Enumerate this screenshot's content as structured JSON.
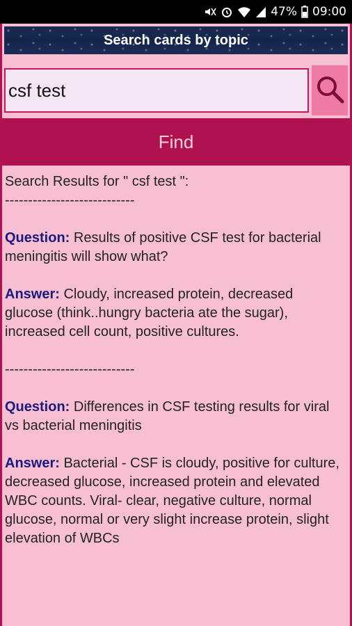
{
  "status": {
    "battery_percent": "47%",
    "time": "09:00"
  },
  "header": {
    "title": "Search cards by topic"
  },
  "search": {
    "query": "csf test",
    "find_label": "Find"
  },
  "results": {
    "heading": "Search Results for \" csf test \":",
    "divider": "----------------------------",
    "question_label": "Question:",
    "answer_label": "Answer:",
    "items": [
      {
        "question": "Results of positive CSF test for bacterial meningitis will show what?",
        "answer": "Cloudy, increased protein, decreased glucose (think..hungry bacteria ate the sugar), increased cell count, positive cultures."
      },
      {
        "question": "Differences in CSF testing results for viral vs bacterial meningitis",
        "answer": "Bacterial - CSF is cloudy, positive for culture, decreased glucose, increased protein and elevated WBC counts. Viral- clear, negative culture, normal glucose, normal or very slight increase protein, slight elevation of WBCs"
      }
    ]
  },
  "icons": [
    "mute-icon",
    "alarm-icon",
    "wifi-icon",
    "signal-icon",
    "battery-icon",
    "search-icon"
  ],
  "colors": {
    "accent": "#b0124f",
    "background": "#f8bfd2",
    "label": "#1a1a7c"
  }
}
